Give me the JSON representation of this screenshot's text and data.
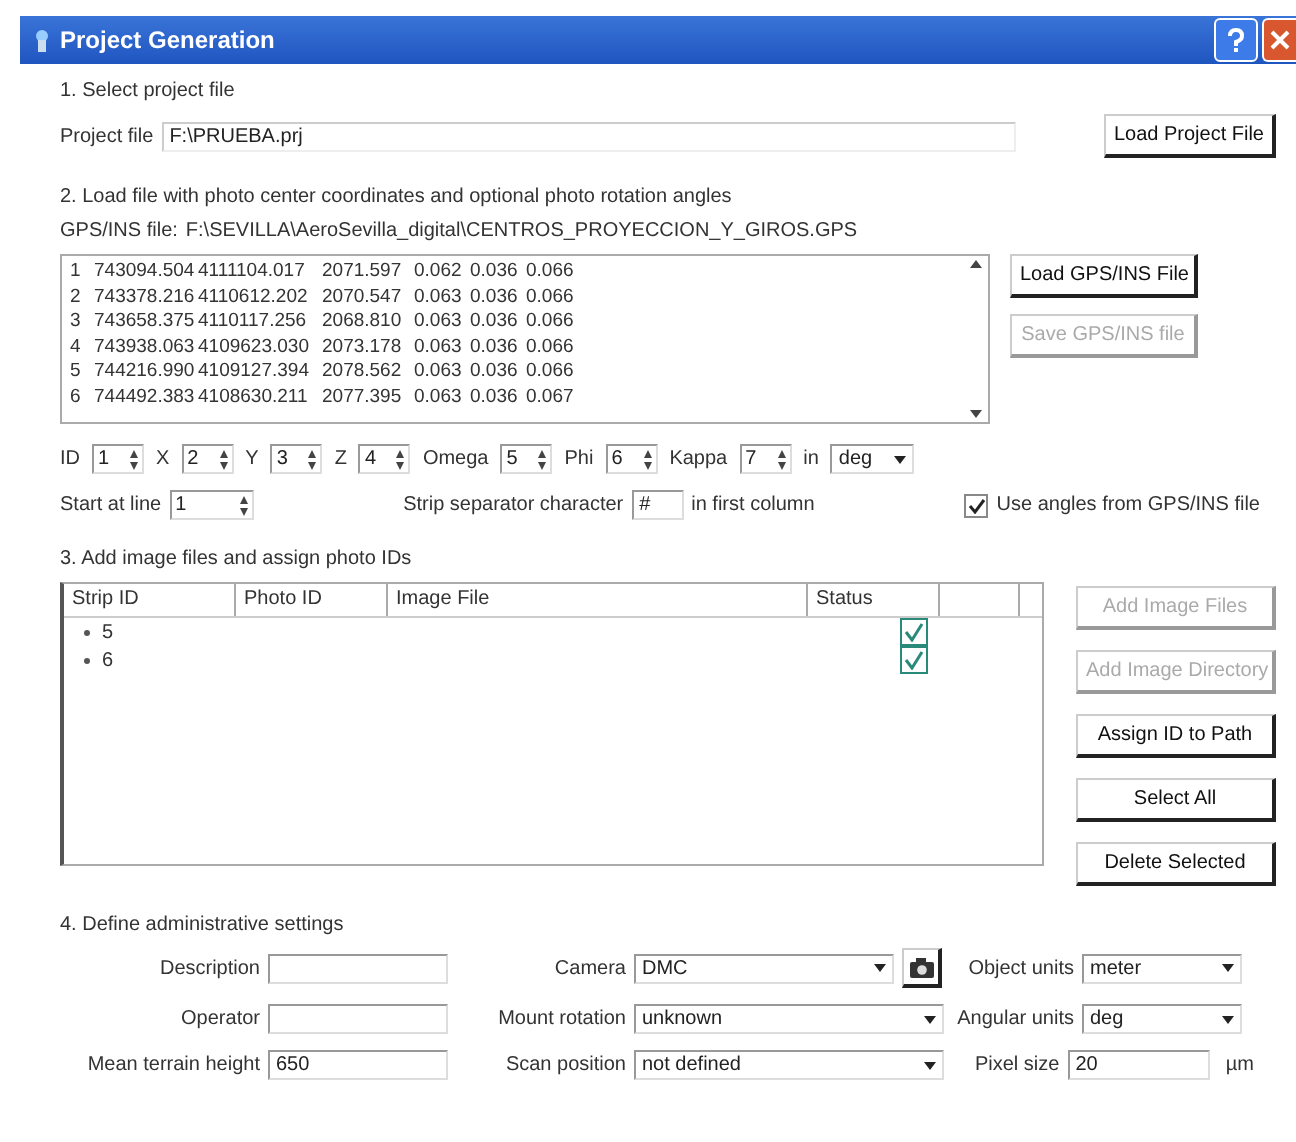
{
  "window": {
    "title": "Project Generation"
  },
  "section_1": {
    "heading": "1. Select project file",
    "project_file": {
      "label": "Project file",
      "value": "F:\\PRUEBA.prj"
    },
    "button": {
      "label": "Load Project File",
      "disabled": false
    }
  },
  "section_2": {
    "heading": "2. Load file with photo center coordinates and optional photo rotation angles",
    "gps_file": {
      "label": "GPS/INS file:",
      "value": "F:\\SEVILLA\\AeroSevilla_digital\\CENTROS_PROYECCION_Y_GIROS.GPS"
    },
    "rows": [
      {
        "index": "1",
        "values": [
          "743094.504",
          "4111104.017",
          "2071.597",
          "0.062",
          "0.036",
          "0.066"
        ]
      },
      {
        "index": "2",
        "values": [
          "743378.216",
          "4110612.202",
          "2070.547",
          "0.063",
          "0.036",
          "0.066"
        ]
      },
      {
        "index": "3",
        "values": [
          "743658.375",
          "4110117.256",
          "2068.810",
          "0.063",
          "0.036",
          "0.066"
        ]
      },
      {
        "index": "4",
        "values": [
          "743938.063",
          "4109623.030",
          "2073.178",
          "0.063",
          "0.036",
          "0.066"
        ]
      },
      {
        "index": "5",
        "values": [
          "744216.990",
          "4109127.394",
          "2078.562",
          "0.063",
          "0.036",
          "0.066"
        ]
      },
      {
        "index": "6",
        "values": [
          "744492.383",
          "4108630.211",
          "2077.395",
          "0.063",
          "0.036",
          "0.067"
        ]
      }
    ],
    "buttons": [
      {
        "label": "Load GPS/INS File",
        "disabled": false
      },
      {
        "label": "Save GPS/INS file",
        "disabled": true
      }
    ],
    "columns": [
      {
        "label": "ID",
        "value": "1"
      },
      {
        "label": "X",
        "value": "2"
      },
      {
        "label": "Y",
        "value": "3"
      },
      {
        "label": "Z",
        "value": "4"
      },
      {
        "label": "Omega",
        "value": "5"
      },
      {
        "label": "Phi",
        "value": "6"
      },
      {
        "label": "Kappa",
        "value": "7"
      }
    ],
    "units": {
      "label": "in",
      "value": "deg"
    },
    "start_line": {
      "label": "Start at line",
      "value": "1"
    },
    "separator": {
      "label": "Strip separator character",
      "value": "#",
      "suffix": "in first column"
    },
    "use_angles": {
      "label": "Use angles from GPS/INS file",
      "checked": true
    }
  },
  "section_3": {
    "heading": "3. Add image files and assign photo IDs",
    "columns": [
      "Strip ID",
      "Photo ID",
      "Image File",
      "Status"
    ],
    "strips": [
      {
        "strip_id": "5",
        "status_checked": true
      },
      {
        "strip_id": "6",
        "status_checked": true
      }
    ],
    "buttons": [
      {
        "label": "Add Image Files",
        "disabled": true
      },
      {
        "label": "Add Image Directory",
        "disabled": true
      },
      {
        "label": "Assign ID to Path",
        "disabled": false
      },
      {
        "label": "Select All",
        "disabled": false
      },
      {
        "label": "Delete Selected",
        "disabled": false
      }
    ]
  },
  "section_4": {
    "heading": "4. Define administrative settings",
    "fields": [
      {
        "kind": "text",
        "label": "Description"
      },
      {
        "kind": "dropdown",
        "label": "Camera",
        "value": "DMC",
        "camera_button": true
      },
      {
        "kind": "dropdown",
        "label": "Object units",
        "value": "meter"
      },
      {
        "kind": "text",
        "label": "Operator"
      },
      {
        "kind": "dropdown",
        "label": "Mount rotation",
        "value": "unknown"
      },
      {
        "kind": "dropdown",
        "label": "Angular units",
        "value": "deg"
      },
      {
        "kind": "text",
        "label": "Mean terrain height",
        "value": "650"
      },
      {
        "kind": "dropdown",
        "label": "Scan position",
        "value": "not defined"
      },
      {
        "kind": "text",
        "label": "Pixel size",
        "value": "20",
        "unit": "µm"
      }
    ]
  }
}
